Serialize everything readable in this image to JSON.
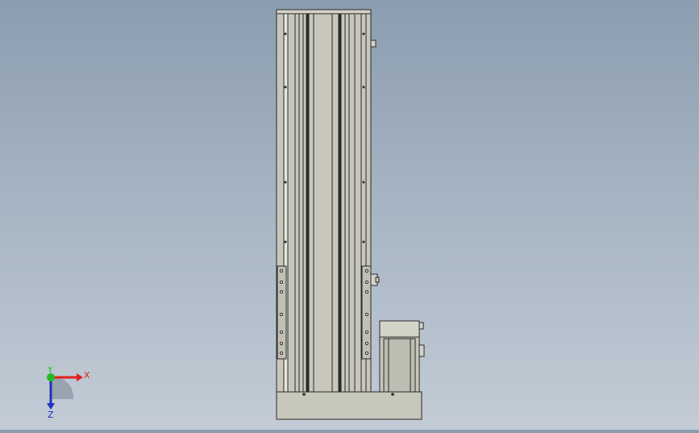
{
  "viewport": {
    "background_top": "#8b9db0",
    "background_bottom": "#c3ccd6"
  },
  "model": {
    "part_fill": "#c8c7bb",
    "part_fill_light": "#d4d3c8",
    "part_fill_dark": "#b3b2a6",
    "edge_color": "#2a2a2a"
  },
  "triad": {
    "x_label": "X",
    "y_label": "Y",
    "z_label": "Z",
    "x_color": "#e0201b",
    "y_color": "#22bb22",
    "z_color": "#2030c0"
  }
}
